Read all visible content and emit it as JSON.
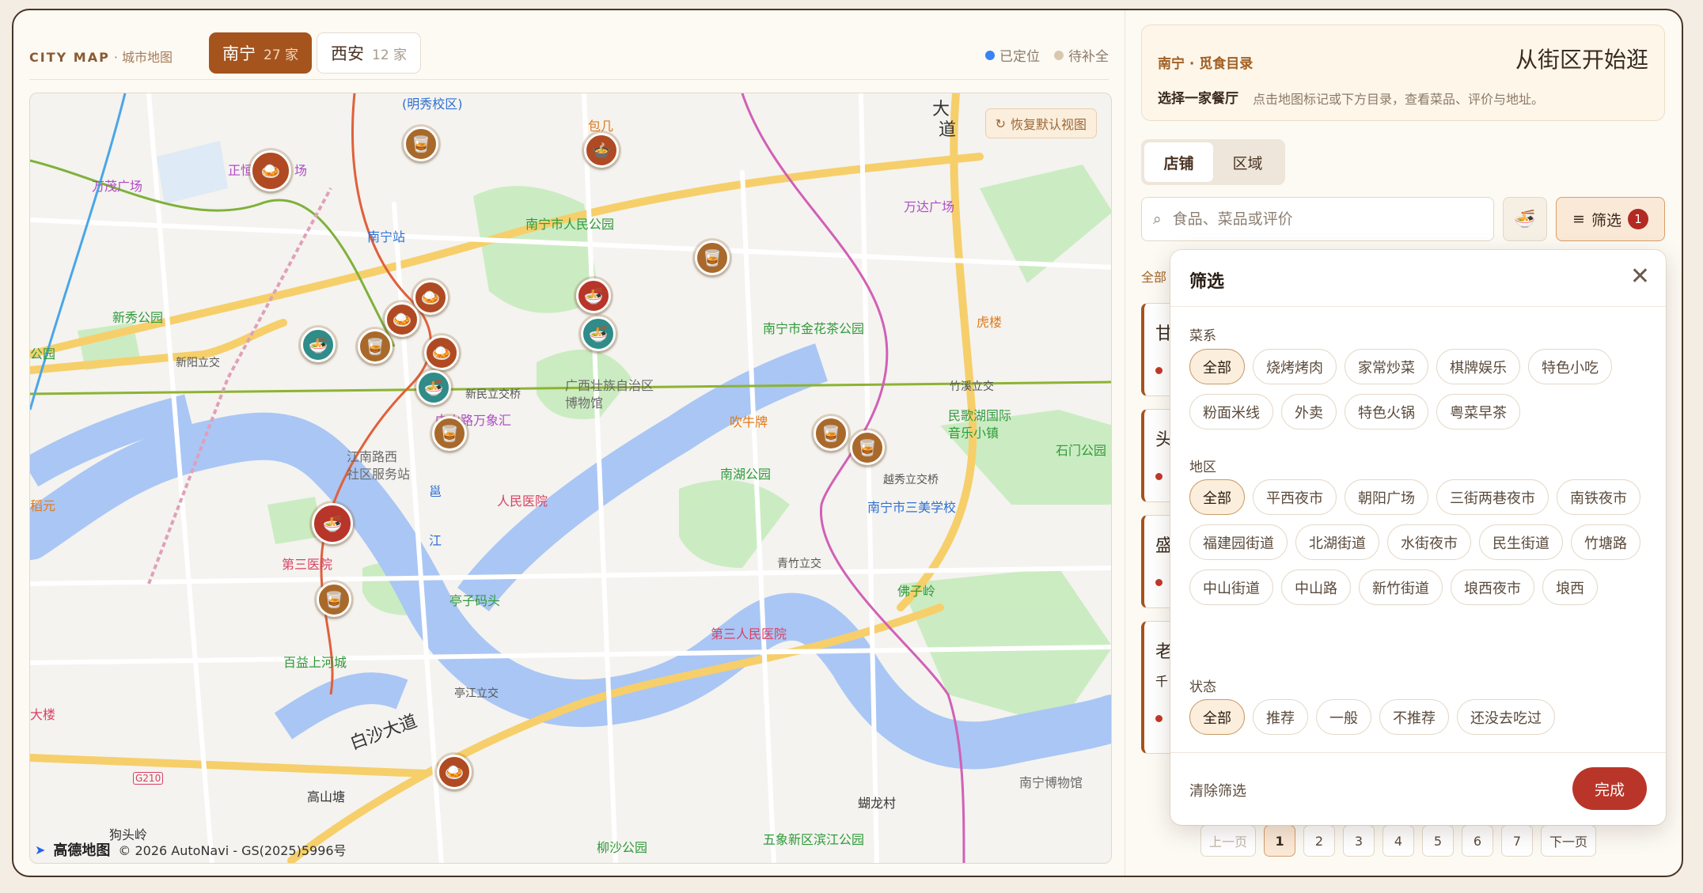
{
  "header": {
    "brand": "CITY MAP",
    "brand_sub": " · 城市地图",
    "cities": [
      {
        "name": "南宁",
        "count": "27 家"
      },
      {
        "name": "西安",
        "count": "12 家"
      }
    ],
    "legend": [
      {
        "label": "已定位",
        "color": "#3b82f6"
      },
      {
        "label": "待补全",
        "color": "#d9c8b0"
      }
    ]
  },
  "map": {
    "reset_label": "恢复默认视图",
    "attribution_logo": "高德地图",
    "attribution": "© 2026 AutoNavi - GS(2025)5996号",
    "labels": [
      {
        "text": "(明秀校区)",
        "cls": "blue"
      },
      {
        "text": "包几",
        "cls": "orange"
      },
      {
        "text": "大",
        "cls": "dark"
      },
      {
        "text": "道",
        "cls": "dark"
      },
      {
        "text": "万茂广场",
        "cls": "purple"
      },
      {
        "text": "正恒",
        "cls": "purple"
      },
      {
        "text": "场",
        "cls": "purple"
      },
      {
        "text": "南宁站",
        "cls": "blue"
      },
      {
        "text": "南宁市人民公园",
        "cls": "green"
      },
      {
        "text": "万达广场",
        "cls": "purple"
      },
      {
        "text": "新秀公园",
        "cls": "green"
      },
      {
        "text": "公园",
        "cls": "green"
      },
      {
        "text": "新阳立交",
        "cls": "gray"
      },
      {
        "text": "虎楼",
        "cls": "orange"
      },
      {
        "text": "南宁市金花茶公园",
        "cls": "green"
      },
      {
        "text": "广西壮族自治区",
        "cls": "grey2"
      },
      {
        "text": "博物馆",
        "cls": "grey2"
      },
      {
        "text": "新民立交桥",
        "cls": "gray"
      },
      {
        "text": "竹溪立交",
        "cls": "gray"
      },
      {
        "text": "中山路万象汇",
        "cls": "purple"
      },
      {
        "text": "吹牛牌",
        "cls": "orange"
      },
      {
        "text": "民歌湖国际",
        "cls": "green"
      },
      {
        "text": "音乐小镇",
        "cls": "green"
      },
      {
        "text": "石门公园",
        "cls": "green"
      },
      {
        "text": "江南路西",
        "cls": "grey2"
      },
      {
        "text": "社区服务站",
        "cls": "grey2"
      },
      {
        "text": "稻元",
        "cls": "orange"
      },
      {
        "text": "人民医院",
        "cls": "red"
      },
      {
        "text": "南湖公园",
        "cls": "green"
      },
      {
        "text": "越秀立交桥",
        "cls": "gray"
      },
      {
        "text": "南宁市三美学校",
        "cls": "blue"
      },
      {
        "text": "邕",
        "cls": "blue"
      },
      {
        "text": "江",
        "cls": "blue"
      },
      {
        "text": "第三医院",
        "cls": "red"
      },
      {
        "text": "青竹立交",
        "cls": "gray"
      },
      {
        "text": "亭子码头",
        "cls": "green"
      },
      {
        "text": "佛子岭",
        "cls": "green"
      },
      {
        "text": "第三人民医院",
        "cls": "red"
      },
      {
        "text": "百益上河城",
        "cls": "green"
      },
      {
        "text": "亭江立交",
        "cls": "gray"
      },
      {
        "text": "白沙大道",
        "cls": "dark"
      },
      {
        "text": "大楼",
        "cls": "red"
      },
      {
        "text": "高山塘",
        "cls": "dark"
      },
      {
        "text": "南宁博物馆",
        "cls": "grey2"
      },
      {
        "text": "蝴龙村",
        "cls": "dark"
      },
      {
        "text": "狗头岭",
        "cls": "dark"
      },
      {
        "text": "柳沙公园",
        "cls": "green"
      },
      {
        "text": "五象新区滨江公园",
        "cls": "green"
      },
      {
        "text": "G210",
        "cls": "red"
      }
    ],
    "pins": [
      {
        "name": "pin-1",
        "color": "brown",
        "icon": "glass"
      },
      {
        "name": "pin-2",
        "color": "rust",
        "icon": "bowl"
      },
      {
        "name": "pin-3",
        "color": "rust",
        "icon": "dish"
      },
      {
        "name": "pin-4",
        "color": "brown",
        "icon": "glass"
      },
      {
        "name": "pin-5",
        "color": "red",
        "icon": "soup"
      },
      {
        "name": "pin-6",
        "color": "rust",
        "icon": "dish"
      },
      {
        "name": "pin-7",
        "color": "rust",
        "icon": "dish"
      },
      {
        "name": "pin-8",
        "color": "teal",
        "icon": "noodle"
      },
      {
        "name": "pin-9",
        "color": "brown",
        "icon": "glass"
      },
      {
        "name": "pin-10",
        "color": "rust",
        "icon": "dish"
      },
      {
        "name": "pin-11",
        "color": "teal",
        "icon": "noodle"
      },
      {
        "name": "pin-12",
        "color": "teal",
        "icon": "noodle"
      },
      {
        "name": "pin-13",
        "color": "brown",
        "icon": "glass"
      },
      {
        "name": "pin-14",
        "color": "brown",
        "icon": "glass"
      },
      {
        "name": "pin-15",
        "color": "brown",
        "icon": "glass"
      },
      {
        "name": "pin-16",
        "color": "red",
        "icon": "soup"
      },
      {
        "name": "pin-17",
        "color": "brown",
        "icon": "glass"
      },
      {
        "name": "pin-18",
        "color": "rust",
        "icon": "dish"
      }
    ]
  },
  "panel": {
    "kicker": "南宁 · 觅食目录",
    "headline": "从街区开始逛",
    "choose": "选择一家餐厅",
    "hint": "点击地图标记或下方目录，查看菜品、评价与地址。",
    "tabs": [
      "店铺",
      "区域"
    ],
    "search_placeholder": "食品、菜品或评价",
    "filter_label": "筛选",
    "filter_count": "1",
    "behind_all": "全部",
    "card_chars": [
      "甘",
      "头",
      "盛",
      "老"
    ],
    "card_sub": [
      "",
      "",
      "",
      "千"
    ],
    "pager": {
      "prev": "上一页",
      "next": "下一页",
      "pages": [
        "1",
        "2",
        "3",
        "4",
        "5",
        "6",
        "7"
      ]
    }
  },
  "filter": {
    "title": "筛选",
    "sections": [
      {
        "title": "菜系",
        "chips": [
          "全部",
          "烧烤烤肉",
          "家常炒菜",
          "棋牌娱乐",
          "特色小吃",
          "粉面米线",
          "外卖",
          "特色火锅",
          "粤菜早茶"
        ]
      },
      {
        "title": "地区",
        "chips": [
          "全部",
          "平西夜市",
          "朝阳广场",
          "三街两巷夜市",
          "南铁夜市",
          "福建园街道",
          "北湖街道",
          "水街夜市",
          "民生街道",
          "竹塘路",
          "中山街道",
          "中山路",
          "新竹街道",
          "埌西夜市",
          "埌西"
        ]
      },
      {
        "title": "状态",
        "chips": [
          "全部",
          "推荐",
          "一般",
          "不推荐",
          "还没去吃过"
        ]
      }
    ],
    "clear_label": "清除筛选",
    "done_label": "完成"
  }
}
